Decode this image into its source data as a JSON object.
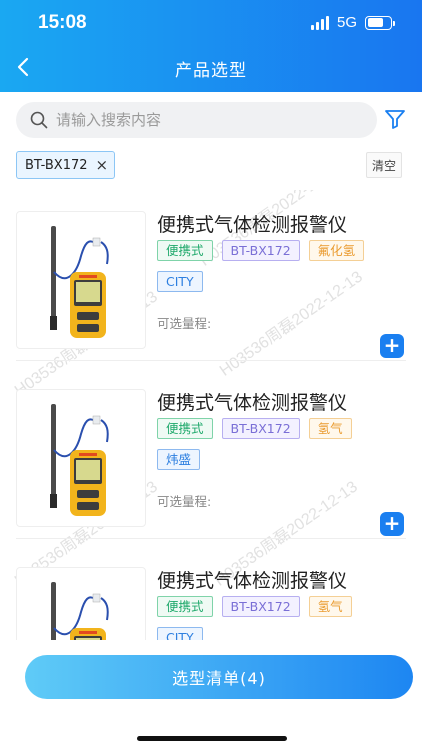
{
  "status_bar": {
    "time": "15:08",
    "network": "5G"
  },
  "nav": {
    "title": "产品选型"
  },
  "search": {
    "placeholder": "请输入搜索内容"
  },
  "filter_chip": {
    "label": "BT-BX172",
    "close": "×"
  },
  "clear_label": "清空",
  "products": [
    {
      "title": "便携式气体检测报警仪",
      "tags": [
        {
          "text": "便携式",
          "color": "green"
        },
        {
          "text": "BT-BX172",
          "color": "purple"
        },
        {
          "text": "氟化氢",
          "color": "orange"
        },
        {
          "text": "CITY",
          "color": "blue"
        }
      ],
      "range_label": "可选量程:"
    },
    {
      "title": "便携式气体检测报警仪",
      "tags": [
        {
          "text": "便携式",
          "color": "green"
        },
        {
          "text": "BT-BX172",
          "color": "purple"
        },
        {
          "text": "氢气",
          "color": "orange"
        },
        {
          "text": "炜盛",
          "color": "blue"
        }
      ],
      "range_label": "可选量程:"
    },
    {
      "title": "便携式气体检测报警仪",
      "tags": [
        {
          "text": "便携式",
          "color": "green"
        },
        {
          "text": "BT-BX172",
          "color": "purple"
        },
        {
          "text": "氢气",
          "color": "orange"
        },
        {
          "text": "CITY",
          "color": "blue"
        }
      ],
      "range_label": "可选量程:"
    }
  ],
  "add_symbol": "+",
  "watermark": "H03536周磊2022-12-13",
  "cart_button": {
    "label": "选型清单(4)"
  },
  "colors": {
    "accent": "#1a7ff0",
    "header_start": "#1aa8f2",
    "header_end": "#1976f0"
  },
  "icons": [
    "back-arrow-icon",
    "search-icon",
    "filter-icon",
    "close-icon",
    "plus-icon"
  ]
}
